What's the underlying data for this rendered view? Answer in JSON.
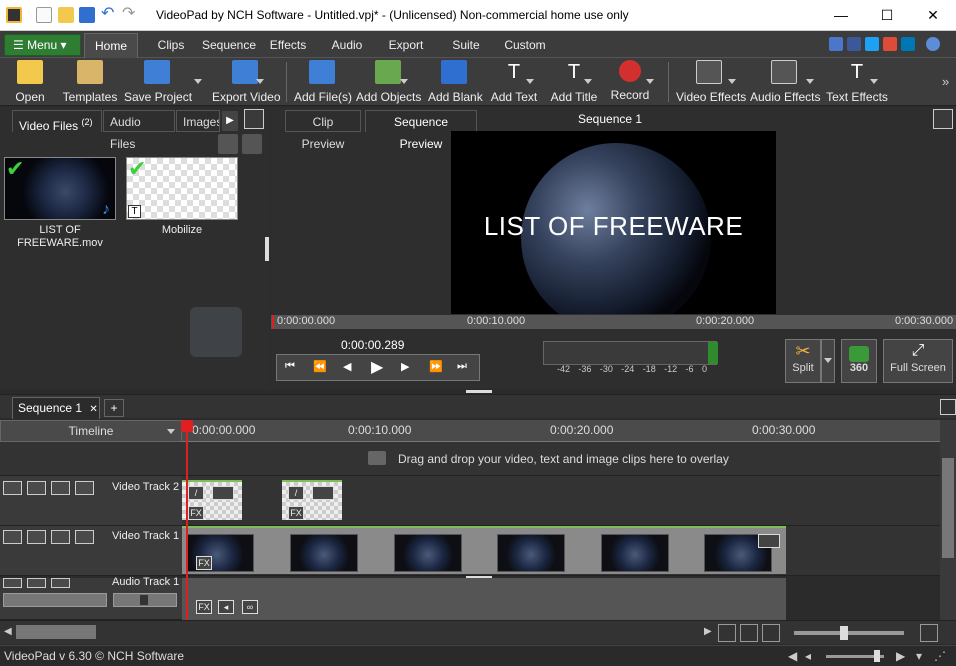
{
  "window": {
    "title": "VideoPad by NCH Software - Untitled.vpj* - (Unlicensed) Non-commercial home use only",
    "minimize": "—",
    "maximize": "☐",
    "close": "✕"
  },
  "menubar": {
    "menu_label": "Menu",
    "tabs": [
      "Home",
      "Clips",
      "Sequence",
      "Effects",
      "Audio",
      "Export",
      "Suite",
      "Custom"
    ],
    "active_tab": "Home"
  },
  "toolbar": {
    "buttons": [
      "Open",
      "Templates",
      "Save Project",
      "Export Video",
      "Add File(s)",
      "Add Objects",
      "Add Blank",
      "Add Text",
      "Add Title",
      "Record",
      "Video Effects",
      "Audio Effects",
      "Text Effects"
    ],
    "more": "»"
  },
  "bin": {
    "tabs": [
      "Video Files",
      "Audio Files",
      "Images"
    ],
    "video_count": "(2)",
    "clips": [
      {
        "name": "LIST OF FREEWARE.mov"
      },
      {
        "name": "Mobilize"
      }
    ]
  },
  "preview": {
    "tabs": [
      "Clip Preview",
      "Sequence Preview"
    ],
    "sequence_title": "Sequence 1",
    "screen_text": "LIST OF FREEWARE",
    "ruler": [
      "0:00:00.000",
      "0:00:10.000",
      "0:00:20.000",
      "0:00:30.000"
    ],
    "time": "0:00:00.289",
    "meter_labels": [
      "-42",
      "-36",
      "-30",
      "-24",
      "-18",
      "-12",
      "-6",
      "0"
    ],
    "split_label": "Split",
    "vr_label": "360",
    "fullscreen_label": "Full Screen"
  },
  "sequence": {
    "tab_label": "Sequence 1",
    "close": "✕",
    "add": "+"
  },
  "timeline": {
    "header_label": "Timeline",
    "ruler": [
      "0:00:00.000",
      "0:00:10.000",
      "0:00:20.000",
      "0:00:30.000"
    ],
    "overlay_hint": "Drag and drop your video, text and image clips here to overlay",
    "tracks": [
      {
        "name": "Video Track 2"
      },
      {
        "name": "Video Track 1"
      },
      {
        "name": "Audio Track 1"
      }
    ],
    "fx_label": "FX"
  },
  "status": {
    "text": "VideoPad v 6.30 © NCH Software"
  },
  "colors": {
    "accent_green": "#2e7d32",
    "playhead": "#e02020",
    "clip_band": "#7cbf5a",
    "record": "#d32f2f"
  }
}
